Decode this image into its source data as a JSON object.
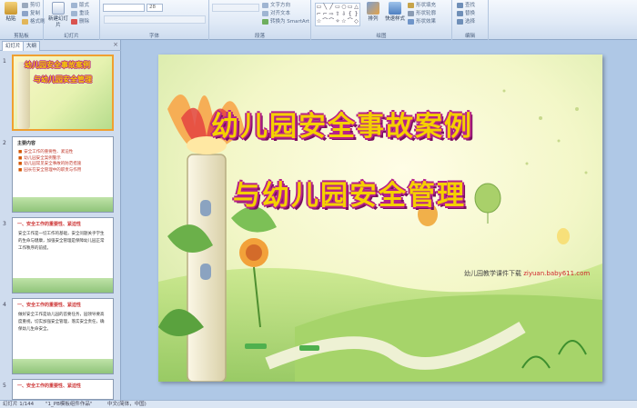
{
  "ribbon": {
    "clipboard": {
      "label": "剪贴板",
      "paste": "粘贴",
      "cut": "剪切",
      "copy": "复制",
      "format": "格式刷"
    },
    "slides": {
      "label": "幻灯片",
      "new_slide": "新建幻灯片",
      "layout": "版式",
      "reset": "重设",
      "delete": "删除"
    },
    "font": {
      "label": "字体",
      "font_value": "",
      "size_value": "28"
    },
    "paragraph": {
      "label": "段落",
      "text_direction": "文字方向",
      "align_text": "对齐文本",
      "smartart": "转换为 SmartArt"
    },
    "drawing": {
      "label": "绘图",
      "shapes": [
        "▭",
        "╲",
        "╱",
        "▭",
        "○",
        "▭",
        "△",
        "⌐",
        "⌐",
        "⇨",
        "⇧",
        "⇩",
        "{ ",
        "}",
        "☆",
        "⌒",
        "⌒",
        "✧",
        "☆",
        "⌒",
        "◇"
      ],
      "arrange": "排列",
      "quick_styles": "快速样式",
      "fill": "形状填充",
      "outline": "形状轮廓",
      "effects": "形状效果"
    },
    "editing": {
      "label": "编辑",
      "find": "查找",
      "replace": "替换",
      "select": "选择"
    }
  },
  "panel": {
    "tab_slides": "幻灯片",
    "tab_outline": "大纲",
    "close": "×",
    "thumbs": [
      {
        "num": "1",
        "title_line1": "幼儿园安全事故案例",
        "title_line2": "与幼儿园安全管理"
      },
      {
        "num": "2",
        "heading": "主要内容",
        "items": [
          "安全工作的重要性、紧迫性",
          "幼儿园安全案例警示",
          "幼儿园常见安全事故的防范措施",
          "园长在安全管理中的职责与作用"
        ]
      },
      {
        "num": "3",
        "heading": "一、安全工作的重要性、紧迫性",
        "text": "安全工作是一切工作的基础，安全问题关乎学生的生命与健康，加强安全管理是保障幼儿园正常工作秩序的前提。"
      },
      {
        "num": "4",
        "heading": "一、安全工作的重要性、紧迫性",
        "text": "做好安全工作是幼儿园的首要任务，园领导要高度重视，切实加强安全管理，落实安全责任，确保幼儿生命安全。"
      },
      {
        "num": "5",
        "heading": "一、安全工作的重要性、紧迫性",
        "text": ""
      }
    ]
  },
  "slide": {
    "title_line1": "幼儿园安全事故案例",
    "title_line2": "与幼儿园安全管理",
    "caption": "幼儿园教学课件下载",
    "caption_url": "ziyuan.baby611.com"
  },
  "status": {
    "slide_info": "幻灯片 1/144",
    "theme": "\"1_PB模板组件作品\"",
    "language": "中文(简体，中国)"
  },
  "colors": {
    "title_fill": "#f5d000",
    "title_outline": "#b6208a",
    "ribbon": "#dfe9f6",
    "canvas": "#afc8e6"
  }
}
